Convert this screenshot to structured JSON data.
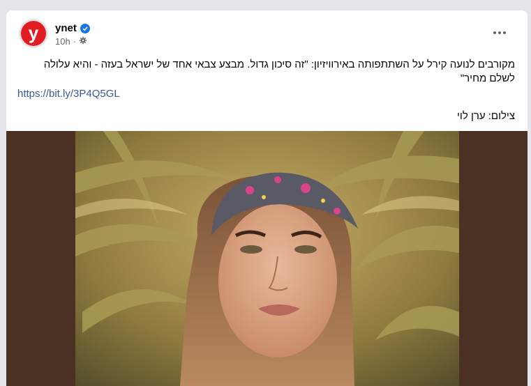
{
  "post": {
    "page_name": "ynet",
    "avatar_letter": "y",
    "timestamp": "10h",
    "separator": "·",
    "text": "מקורבים לנועה קירל על השתתפותה באירוויזיון: \"זה סיכון גדול. מבצע צבאי אחד של ישראל בעזה - והיא עלולה לשלם מחיר\"",
    "link": "https://bit.ly/3P4Q5GL",
    "credit": "צילום: ערן לוי"
  },
  "icons": {
    "verified": "verified-badge-icon",
    "audience": "globe-gear-icon",
    "more": "more-options-icon"
  },
  "colors": {
    "brand": "#e21c23",
    "verified": "#1b74e4",
    "link": "#385898",
    "photo_background": "#4b3024"
  }
}
